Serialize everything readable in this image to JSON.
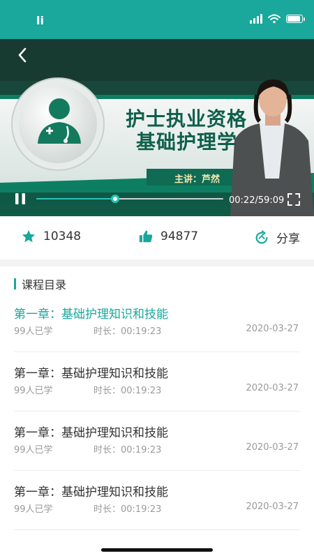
{
  "status_bar": {
    "left_text": "li"
  },
  "video": {
    "title_line1": "护士执业资格",
    "title_line2": "基础护理学",
    "lecturer": "主讲：芦然",
    "time": "00:22/59:09",
    "progress": 0.42
  },
  "stats": {
    "favorites": "10348",
    "likes": "94877",
    "share_label": "分享"
  },
  "catalog": {
    "title": "课程目录",
    "items": [
      {
        "title": "第一章：基础护理知识和技能",
        "learners": "99人已学",
        "duration": "时长：00:19:23",
        "date": "2020-03-27",
        "active": true
      },
      {
        "title": "第一章：基础护理知识和技能",
        "learners": "99人已学",
        "duration": "时长：00:19:23",
        "date": "2020-03-27",
        "active": false
      },
      {
        "title": "第一章：基础护理知识和技能",
        "learners": "99人已学",
        "duration": "时长：00:19:23",
        "date": "2020-03-27",
        "active": false
      },
      {
        "title": "第一章：基础护理知识和技能",
        "learners": "99人已学",
        "duration": "时长：00:19:23",
        "date": "2020-03-27",
        "active": false
      }
    ]
  },
  "colors": {
    "accent": "#1aa79c",
    "video_dark": "#0f5b47"
  }
}
